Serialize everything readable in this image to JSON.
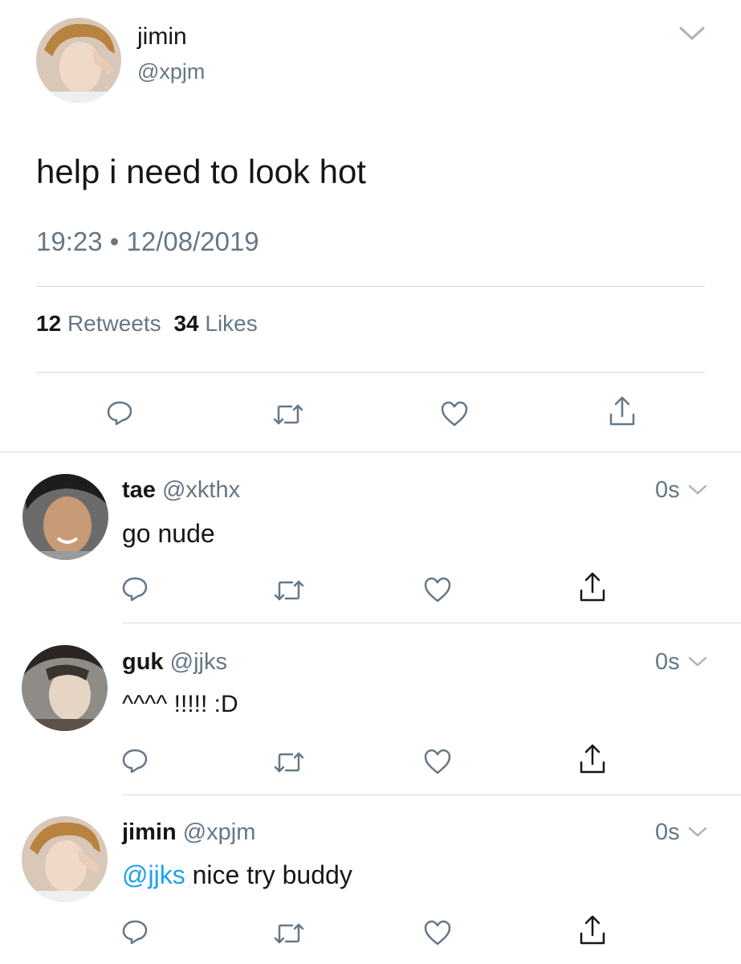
{
  "main_tweet": {
    "name": "jimin",
    "handle": "@xpjm",
    "text": "help i need to look hot",
    "time": "19:23",
    "separator": "•",
    "date": "12/08/2019",
    "retweets_count": "12",
    "retweets_label": "Retweets",
    "likes_count": "34",
    "likes_label": "Likes",
    "actions": [
      "reply-icon",
      "retweet-icon",
      "like-icon",
      "share-icon"
    ]
  },
  "replies": [
    {
      "name": "tae",
      "handle": "@xkthx",
      "time": "0s",
      "text": "go nude"
    },
    {
      "name": "guk",
      "handle": "@jjks",
      "time": "0s",
      "text": "^^^^ !!!!! :D"
    },
    {
      "name": "jimin",
      "handle": "@xpjm",
      "time": "0s",
      "mention": "@jjks",
      "text": " nice try buddy"
    }
  ],
  "colors": {
    "text": "#14171a",
    "secondary": "#657786",
    "link": "#1da1f2",
    "divider": "#d6dbdf"
  }
}
